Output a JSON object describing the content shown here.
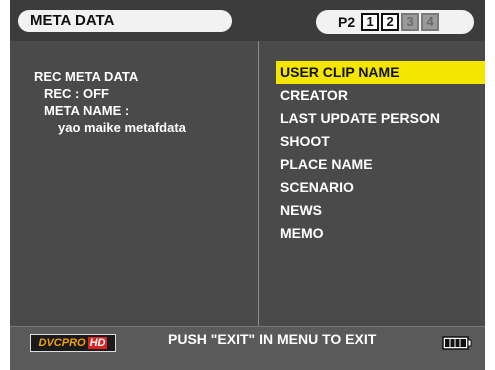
{
  "header": {
    "title": "META DATA",
    "card_label": "P2",
    "slots": [
      {
        "label": "1",
        "active": true
      },
      {
        "label": "2",
        "active": true
      },
      {
        "label": "3",
        "active": false
      },
      {
        "label": "4",
        "active": false
      }
    ]
  },
  "left_panel": {
    "heading": "REC META DATA",
    "rec_status": "REC : OFF",
    "meta_name_label": "META NAME :",
    "meta_name_value": "yao maike metafdata"
  },
  "menu": {
    "items": [
      {
        "label": "USER CLIP NAME",
        "selected": true
      },
      {
        "label": "CREATOR",
        "selected": false
      },
      {
        "label": "LAST UPDATE PERSON",
        "selected": false
      },
      {
        "label": "SHOOT",
        "selected": false
      },
      {
        "label": "PLACE NAME",
        "selected": false
      },
      {
        "label": "SCENARIO",
        "selected": false
      },
      {
        "label": "NEWS",
        "selected": false
      },
      {
        "label": "MEMO",
        "selected": false
      }
    ]
  },
  "footer": {
    "logo_text_main": "DVCPRO",
    "logo_text_hd": "HD",
    "message": "PUSH \"EXIT\" IN MENU TO EXIT",
    "battery_icon": "battery-icon"
  },
  "colors": {
    "highlight": "#f5e600",
    "background": "#4a4a4a",
    "text": "#ffffff"
  }
}
